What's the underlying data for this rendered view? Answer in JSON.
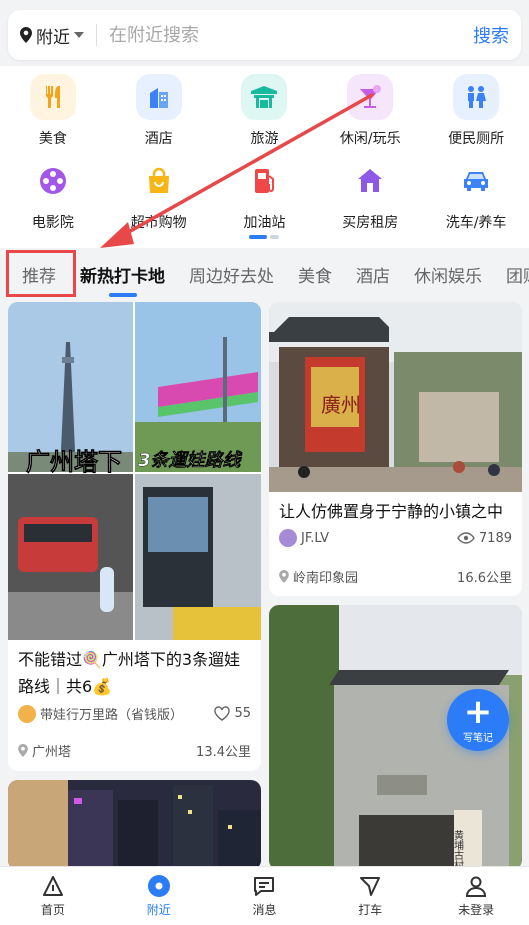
{
  "search": {
    "location": "附近",
    "placeholder": "在附近搜索",
    "button": "搜索"
  },
  "categories": [
    {
      "label": "美食",
      "icon": "fork-knife-icon",
      "color": "#f7a319",
      "bg": "#fff4e0"
    },
    {
      "label": "酒店",
      "icon": "hotel-building-icon",
      "color": "#3b82f6",
      "bg": "#e6f0ff"
    },
    {
      "label": "旅游",
      "icon": "temple-icon",
      "color": "#19b9a0",
      "bg": "#def7f2"
    },
    {
      "label": "休闲/玩乐",
      "icon": "cocktail-icon",
      "color": "#c65ce8",
      "bg": "#f6e6fc"
    },
    {
      "label": "便民厕所",
      "icon": "restroom-icon",
      "color": "#3b82f6",
      "bg": "#e6f0ff"
    },
    {
      "label": "电影院",
      "icon": "film-reel-icon",
      "color": "#a357e8",
      "bg": "#ffffff"
    },
    {
      "label": "超市购物",
      "icon": "shopping-bag-icon",
      "color": "#f7b516",
      "bg": "#ffffff"
    },
    {
      "label": "加油站",
      "icon": "gas-station-icon",
      "color": "#f04848",
      "bg": "#ffffff"
    },
    {
      "label": "买房租房",
      "icon": "house-icon",
      "color": "#8e59e6",
      "bg": "#ffffff"
    },
    {
      "label": "洗车/养车",
      "icon": "car-icon",
      "color": "#3b82f6",
      "bg": "#ffffff"
    }
  ],
  "tabs": [
    "推荐",
    "新热打卡地",
    "周边好去处",
    "美食",
    "酒店",
    "休闲娱乐",
    "团购"
  ],
  "active_tab": "新热打卡地",
  "cards": [
    {
      "image_caption_a": "广州塔下",
      "image_caption_b": "3条遛娃路线",
      "title": "不能错过🍭广州塔下的3条遛娃路线｜共6💰",
      "author": "带娃行万里路（省钱版）",
      "likes": "55",
      "place": "广州塔",
      "distance": "13.4公里"
    },
    {
      "sign_text": "廣州",
      "title": "让人仿佛置身于宁静的小镇之中",
      "author": "JF.LV",
      "views": "7189",
      "place": "岭南印象园",
      "distance": "16.6公里"
    },
    {
      "place": "",
      "distance": ""
    },
    {
      "sign_text": "黄埔古村"
    }
  ],
  "fab": {
    "label": "写笔记"
  },
  "nav": [
    {
      "label": "首页",
      "icon": "home-triangle-icon"
    },
    {
      "label": "附近",
      "icon": "nearby-dot-icon"
    },
    {
      "label": "消息",
      "icon": "message-icon"
    },
    {
      "label": "打车",
      "icon": "taxi-icon"
    },
    {
      "label": "未登录",
      "icon": "user-icon"
    }
  ],
  "colors": {
    "accent": "#2b7cf6",
    "highlight": "#e84848",
    "annotation_arrow": "#e84848"
  }
}
